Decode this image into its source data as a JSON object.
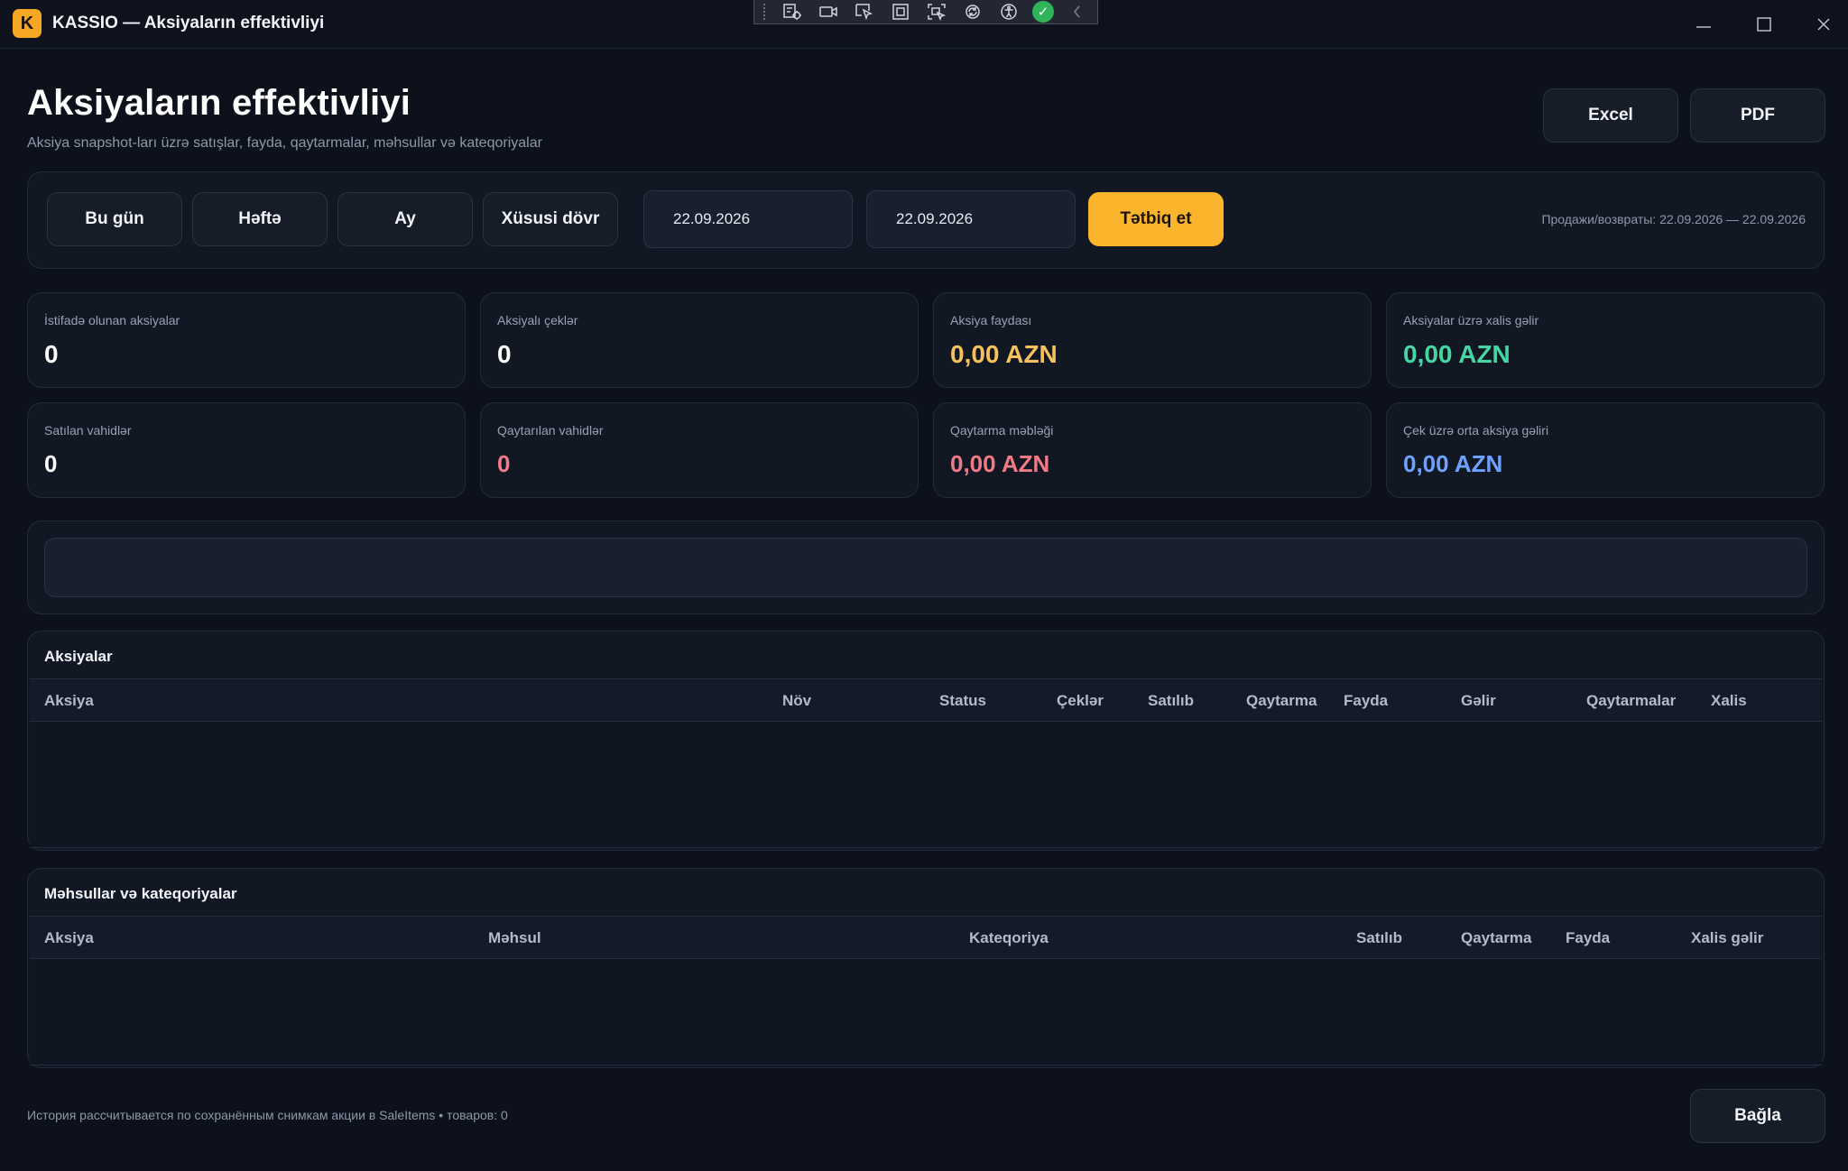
{
  "window": {
    "logo_letter": "K",
    "title": "KASSIO — Aksiyaların effektivliyi"
  },
  "header": {
    "title": "Aksiyaların effektivliyi",
    "subtitle": "Aksiya snapshot-ları üzrə satışlar, fayda, qaytarmalar, məhsullar və kateqoriyalar",
    "export_excel": "Excel",
    "export_pdf": "PDF"
  },
  "filters": {
    "today": "Bu gün",
    "week": "Həftə",
    "month": "Ay",
    "custom": "Xüsusi dövr",
    "date_from": "22.09.2026",
    "date_to": "22.09.2026",
    "apply": "Tətbiq et",
    "period_info": "Продажи/возвраты: 22.09.2026 — 22.09.2026"
  },
  "stats": [
    {
      "label": "İstifadə olunan aksiyalar",
      "value": "0",
      "color": "#ffffff"
    },
    {
      "label": "Aksiyalı çeklər",
      "value": "0",
      "color": "#ffffff"
    },
    {
      "label": "Aksiya faydası",
      "value": "0,00 AZN",
      "color": "#f6c15b"
    },
    {
      "label": "Aksiyalar üzrə xalis gəlir",
      "value": "0,00 AZN",
      "color": "#45d6a4"
    },
    {
      "label": "Satılan vahidlər",
      "value": "0",
      "color": "#ffffff"
    },
    {
      "label": "Qaytarılan vahidlər",
      "value": "0",
      "color": "#f07a86"
    },
    {
      "label": "Qaytarma məbləği",
      "value": "0,00 AZN",
      "color": "#f07a86"
    },
    {
      "label": "Çek üzrə orta aksiya gəliri",
      "value": "0,00 AZN",
      "color": "#6fa2ff"
    }
  ],
  "search": {
    "value": ""
  },
  "promotions_table": {
    "title": "Aksiyalar",
    "columns": [
      "Aksiya",
      "Növ",
      "Status",
      "Çeklər",
      "Satılıb",
      "Qaytarma",
      "Fayda",
      "Gəlir",
      "Qaytarmalar",
      "Xalis"
    ],
    "rows": []
  },
  "products_table": {
    "title": "Məhsullar və kateqoriyalar",
    "columns": [
      "Aksiya",
      "Məhsul",
      "Kateqoriya",
      "Satılıb",
      "Qaytarma",
      "Fayda",
      "Xalis gəlir"
    ],
    "rows": []
  },
  "footer": {
    "note": "История рассчитывается по сохранённым снимкам акции в SaleItems • товаров: 0",
    "close": "Bağla"
  },
  "colors": {
    "accent": "#fbb52c",
    "background": "#0c111b",
    "panel": "#111723"
  }
}
